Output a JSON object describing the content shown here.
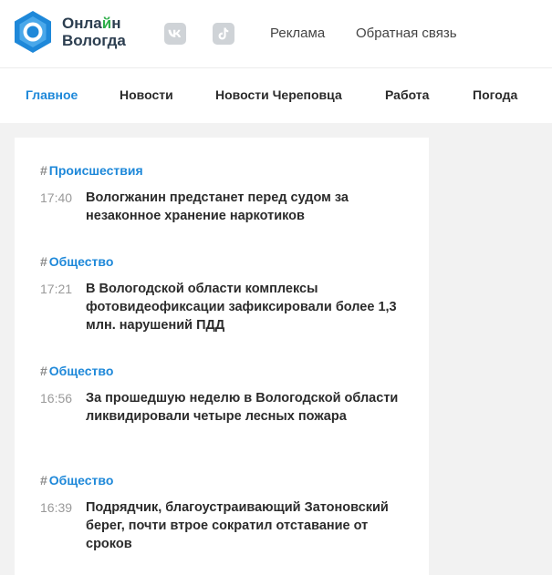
{
  "brand": {
    "line1_start": "Онла",
    "line1_accent": "й",
    "line1_end": "н",
    "line2": "Вологда",
    "accent_color": "#2eae4a",
    "logo_color": "#1e88d9"
  },
  "social": [
    {
      "name": "vk-icon"
    },
    {
      "name": "tiktok-icon"
    }
  ],
  "top_links": {
    "ads": "Реклама",
    "feedback": "Обратная связь"
  },
  "nav": [
    {
      "label": "Главное",
      "active": true
    },
    {
      "label": "Новости",
      "active": false
    },
    {
      "label": "Новости Череповца",
      "active": false
    },
    {
      "label": "Работа",
      "active": false
    },
    {
      "label": "Погода",
      "active": false
    }
  ],
  "feed": [
    {
      "rubric": "Происшествия",
      "time": "17:40",
      "title": "Вологжанин предстанет перед судом за незаконное хранение наркотиков"
    },
    {
      "rubric": "Общество",
      "time": "17:21",
      "title": "В Вологодской области комплексы фотовидеофиксации зафиксировали более 1,3 млн. нарушений ПДД"
    },
    {
      "rubric": "Общество",
      "time": "16:56",
      "title": "За прошедшую неделю в Вологодской области ликвидировали четыре лесных пожара"
    },
    {
      "rubric": "Общество",
      "time": "16:39",
      "title": "Подрядчик, благоустраивающий Затоновский берег, почти втрое сократил отставание от сроков"
    }
  ],
  "hash_symbol": "#"
}
